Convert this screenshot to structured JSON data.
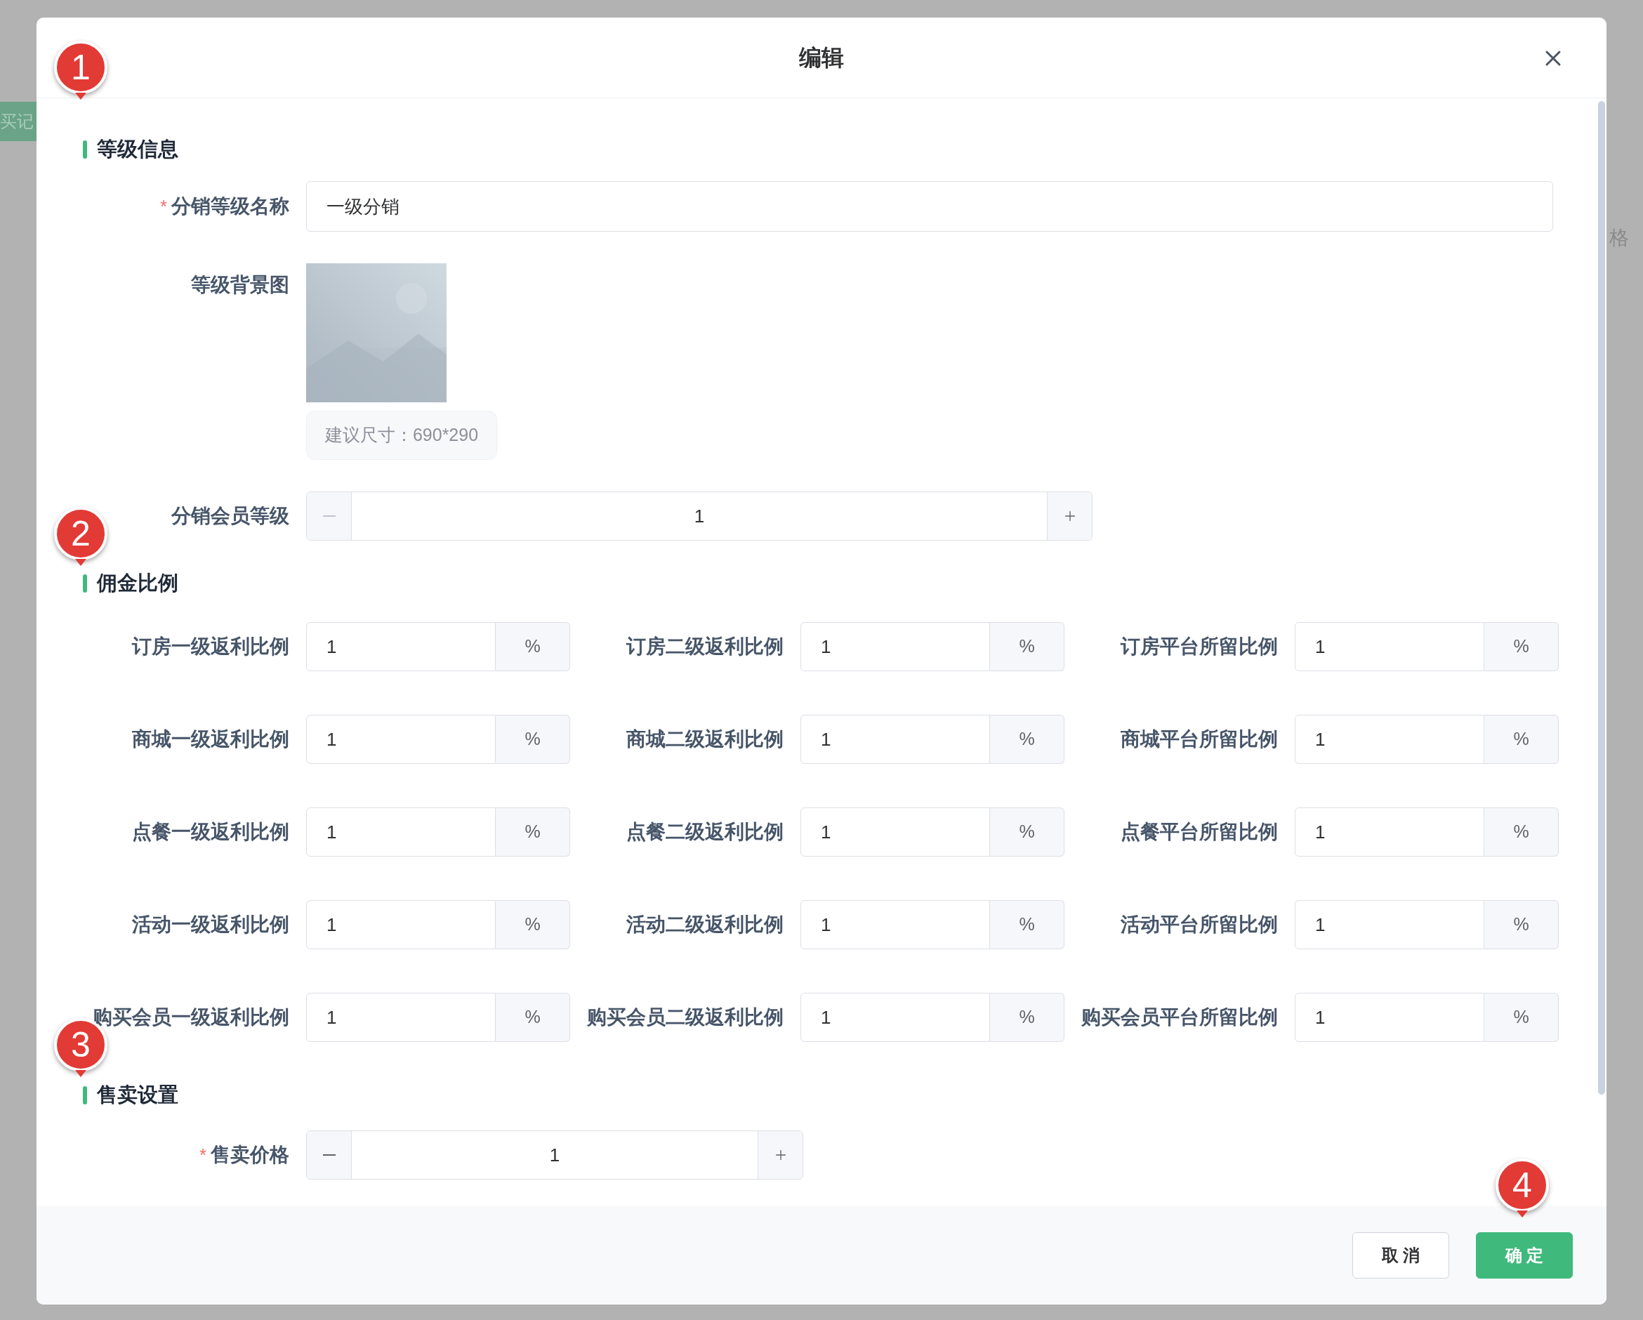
{
  "background": {
    "tab_label": "买记",
    "column_label": "格"
  },
  "dialog_title": "编辑",
  "level_info": {
    "title": "等级信息",
    "marker": "1",
    "name_field": {
      "label": "分销等级名称",
      "required_mark": "*",
      "value": "一级分销"
    },
    "background_image": {
      "label": "等级背景图",
      "hint": "建议尺寸：690*290"
    },
    "member_level": {
      "label": "分销会员等级",
      "value": "1",
      "decrement_disabled": true
    }
  },
  "commission": {
    "title": "佣金比例",
    "marker": "2",
    "rows": [
      [
        {
          "label": "订房一级返利比例",
          "value": "1",
          "unit": "%"
        },
        {
          "label": "订房二级返利比例",
          "value": "1",
          "unit": "%"
        },
        {
          "label": "订房平台所留比例",
          "value": "1",
          "unit": "%"
        }
      ],
      [
        {
          "label": "商城一级返利比例",
          "value": "1",
          "unit": "%"
        },
        {
          "label": "商城二级返利比例",
          "value": "1",
          "unit": "%"
        },
        {
          "label": "商城平台所留比例",
          "value": "1",
          "unit": "%"
        }
      ],
      [
        {
          "label": "点餐一级返利比例",
          "value": "1",
          "unit": "%"
        },
        {
          "label": "点餐二级返利比例",
          "value": "1",
          "unit": "%"
        },
        {
          "label": "点餐平台所留比例",
          "value": "1",
          "unit": "%"
        }
      ],
      [
        {
          "label": "活动一级返利比例",
          "value": "1",
          "unit": "%"
        },
        {
          "label": "活动二级返利比例",
          "value": "1",
          "unit": "%"
        },
        {
          "label": "活动平台所留比例",
          "value": "1",
          "unit": "%"
        }
      ],
      [
        {
          "label": "购买会员一级返利比例",
          "value": "1",
          "unit": "%"
        },
        {
          "label": "购买会员二级返利比例",
          "value": "1",
          "unit": "%"
        },
        {
          "label": "购买会员平台所留比例",
          "value": "1",
          "unit": "%"
        }
      ]
    ]
  },
  "sale": {
    "title": "售卖设置",
    "marker": "3",
    "price": {
      "label": "售卖价格",
      "required_mark": "*",
      "value": "1",
      "decrement_disabled": false
    }
  },
  "buttons": [
    {
      "label": "取 消",
      "kind": "secondary"
    },
    {
      "label": "确 定",
      "kind": "primary",
      "marker": "4"
    }
  ]
}
